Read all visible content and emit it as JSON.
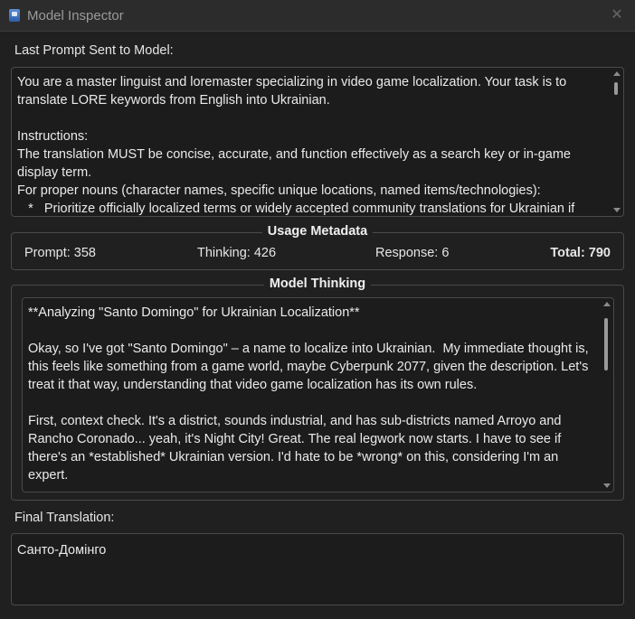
{
  "window": {
    "title": "Model Inspector",
    "close_glyph": "✕"
  },
  "prompt_section": {
    "label": "Last Prompt Sent to Model:",
    "text": "You are a master linguist and loremaster specializing in video game localization. Your task is to translate LORE keywords from English into Ukrainian.\n\nInstructions:\nThe translation MUST be concise, accurate, and function effectively as a search key or in-game display term.\nFor proper nouns (character names, specific unique locations, named items/technologies):\n   *   Prioritize officially localized terms or widely accepted community translations for Ukrainian if"
  },
  "usage_metadata": {
    "title": "Usage Metadata",
    "prompt": "Prompt: 358",
    "thinking": "Thinking: 426",
    "response": "Response: 6",
    "total": "Total: 790"
  },
  "thinking_section": {
    "title": "Model Thinking",
    "text": "**Analyzing \"Santo Domingo\" for Ukrainian Localization**\n\nOkay, so I've got \"Santo Domingo\" – a name to localize into Ukrainian.  My immediate thought is, this feels like something from a game world, maybe Cyberpunk 2077, given the description. Let's treat it that way, understanding that video game localization has its own rules.\n\nFirst, context check. It's a district, sounds industrial, and has sub-districts named Arroyo and Rancho Coronado... yeah, it's Night City! Great. The real legwork now starts. I have to see if there's an *established* Ukrainian version. I'd hate to be *wrong* on this, considering I'm an expert."
  },
  "translation_section": {
    "label": "Final Translation:",
    "value": "Санто-Домінго"
  },
  "icons": [
    "app-icon",
    "close-icon",
    "scroll-up-icon",
    "scroll-down-icon"
  ]
}
